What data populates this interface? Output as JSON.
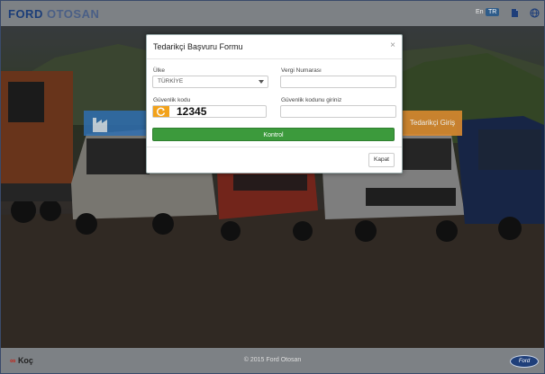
{
  "header": {
    "logo_word1": "FORD",
    "logo_word2": "OTOSAN",
    "lang_en": "En",
    "lang_tr": "TR",
    "icons": [
      "document-icon",
      "globe-icon"
    ]
  },
  "background": {
    "left_tile_icon": "factory-icon",
    "right_tile_label": "Tedarikçi Giriş"
  },
  "modal": {
    "title": "Tedarikçi Başvuru Formu",
    "close_label": "×",
    "country_label": "Ülke",
    "country_value": "TÜRKİYE",
    "tax_label": "Vergi Numarası",
    "tax_value": "",
    "captcha_label": "Güvenlik kodu",
    "captcha_code": "12345",
    "captcha_input_label": "Güvenlik kodunu giriniz",
    "captcha_input_value": "",
    "check_button": "Kontrol",
    "close_button": "Kapat"
  },
  "footer": {
    "brand_mark": "∞",
    "brand": "Koç",
    "copyright": "© 2015 Ford Otosan",
    "ford_logo": "Ford"
  },
  "colors": {
    "header_bg": "#7d8185",
    "brand_blue": "#1b3d78",
    "button_green": "#3c9a3c",
    "refresh_orange": "#f2a21b"
  }
}
